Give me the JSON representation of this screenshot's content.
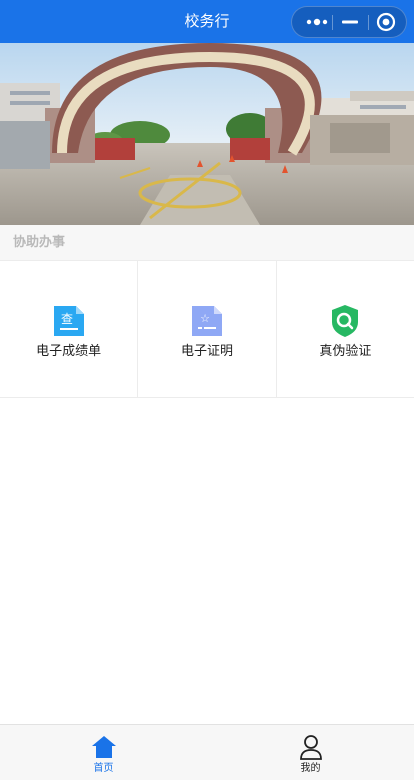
{
  "header": {
    "title": "校务行",
    "more_icon": "more-dots-icon",
    "minimize_icon": "minimize-icon",
    "close_icon": "target-close-icon"
  },
  "banner": {
    "description_icon": "campus-gate-photo"
  },
  "section": {
    "title": "协助办事"
  },
  "services": [
    {
      "label": "电子成绩单",
      "icon": "transcript-icon",
      "icon_glyph": "查",
      "color": "#2aa8f2"
    },
    {
      "label": "电子证明",
      "icon": "certificate-icon",
      "icon_glyph": "☆",
      "color": "#8fa8f5"
    },
    {
      "label": "真伪验证",
      "icon": "verify-shield-icon",
      "icon_glyph": "",
      "color": "#27b863"
    }
  ],
  "tabbar": {
    "items": [
      {
        "label": "首页",
        "icon": "home-icon",
        "active": true
      },
      {
        "label": "我的",
        "icon": "user-icon",
        "active": false
      }
    ]
  },
  "colors": {
    "accent": "#1a73e8",
    "divider": "#ececec",
    "section_bg": "#f7f7f7",
    "section_text": "#b9b9b9"
  }
}
